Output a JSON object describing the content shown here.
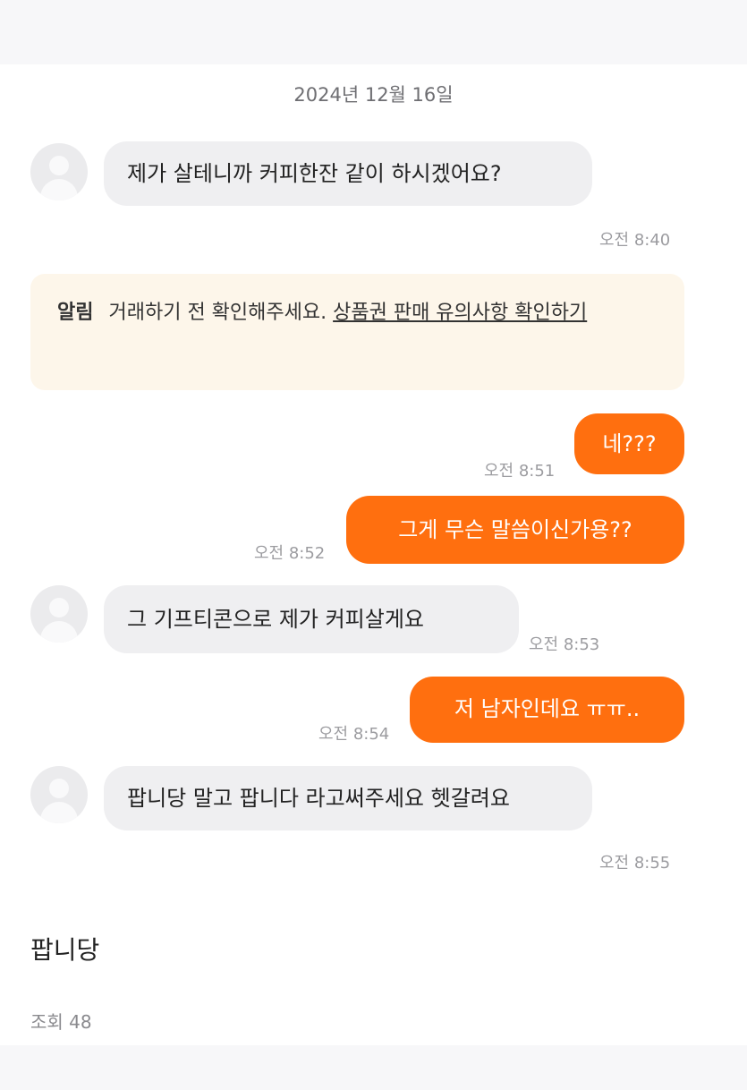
{
  "chat": {
    "date": "2024년 12월 16일",
    "messages": [
      {
        "sender": "other",
        "text": "제가 살테니까 커피한잔 같이 하시겠어요?",
        "time": "오전 8:40"
      },
      {
        "sender": "me",
        "text": "네???",
        "time": "오전 8:51"
      },
      {
        "sender": "me",
        "text": "그게 무슨 말씀이신가용??",
        "time": "오전 8:52"
      },
      {
        "sender": "other",
        "text": "그 기프티콘으로 제가 커피살게요",
        "time": "오전 8:53"
      },
      {
        "sender": "me",
        "text": "저 남자인데요 ㅠㅠ..",
        "time": "오전 8:54"
      },
      {
        "sender": "other",
        "text": "팝니당 말고 팝니다 라고써주세요 헷갈려요",
        "time": "오전 8:55"
      }
    ],
    "notice": {
      "label": "알림",
      "text": "거래하기 전 확인해주세요.",
      "link": "상품권 판매 유의사항 확인하기"
    }
  },
  "post": {
    "title": "팝니당",
    "views": "조회 48"
  },
  "colors": {
    "sent_bubble": "#ff6f0f",
    "received_bubble": "#efeff1",
    "notice_bg": "#fdf6ea"
  }
}
